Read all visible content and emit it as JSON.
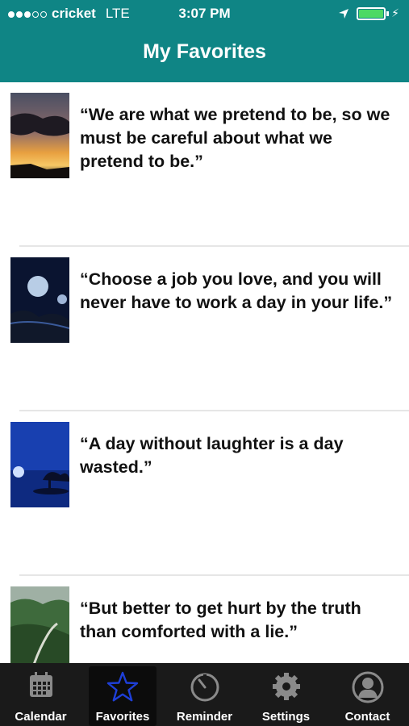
{
  "status": {
    "carrier": "cricket",
    "network": "LTE",
    "time": "3:07 PM"
  },
  "header": {
    "title": "My Favorites"
  },
  "favorites": [
    {
      "quote": "“We are what we pretend to be, so we must be careful about what we pretend to be.”",
      "thumb": "sunset-clouds"
    },
    {
      "quote": "“Choose a job you love, and you will never have to work a day in your life.”",
      "thumb": "night-moons"
    },
    {
      "quote": "“A day without laughter is a day wasted.”",
      "thumb": "blue-moon-tree"
    },
    {
      "quote": "“But better to get hurt by the truth than comforted with a lie.”",
      "thumb": "green-valley"
    }
  ],
  "tabs": [
    {
      "label": "Calendar",
      "icon": "calendar-icon"
    },
    {
      "label": "Favorites",
      "icon": "star-icon",
      "active": true
    },
    {
      "label": "Reminder",
      "icon": "timer-icon"
    },
    {
      "label": "Settings",
      "icon": "gear-icon"
    },
    {
      "label": "Contact",
      "icon": "person-icon"
    }
  ],
  "colors": {
    "header": "#0f8585",
    "tabbar": "#1a1a1a",
    "activeStar": "#1e3fd8"
  }
}
